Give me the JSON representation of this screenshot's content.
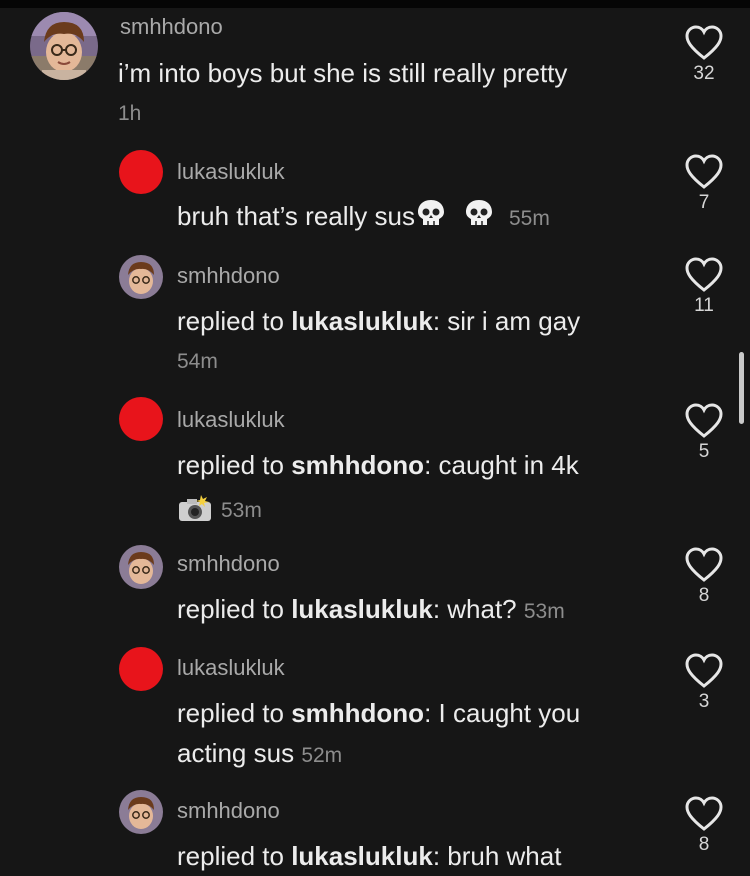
{
  "comments": [
    {
      "username": "smhhdono",
      "text": "i’m into boys but she is still really pretty",
      "time": "1h",
      "likes": "32"
    }
  ],
  "replies": [
    {
      "username": "lukaslukluk",
      "text": "bruh that’s really sus",
      "time": "55m",
      "likes": "7"
    },
    {
      "username": "smhhdono",
      "reply_prefix": "replied to ",
      "reply_to": "lukaslukluk",
      "text": ": sir i am gay",
      "time": "54m",
      "likes": "11"
    },
    {
      "username": "lukaslukluk",
      "reply_prefix": "replied to ",
      "reply_to": "smhhdono",
      "text": ": caught in 4k",
      "time": "53m",
      "likes": "5"
    },
    {
      "username": "smhhdono",
      "reply_prefix": "replied to ",
      "reply_to": "lukaslukluk",
      "text": ": what?",
      "time": "53m",
      "likes": "8"
    },
    {
      "username": "lukaslukluk",
      "reply_prefix": "replied to ",
      "reply_to": "smhhdono",
      "text": ": I caught you",
      "text2": "acting sus",
      "time": "52m",
      "likes": "3"
    },
    {
      "username": "smhhdono",
      "reply_prefix": "replied to ",
      "reply_to": "lukaslukluk",
      "text": ": bruh what",
      "likes": "8"
    }
  ],
  "icons": {
    "like": "heart-outline-icon",
    "skull": "skull-emoji-icon",
    "camera": "camera-flash-emoji-icon"
  },
  "colors": {
    "background": "#161616",
    "avatar_red": "#e8141b",
    "username": "#a9a9a9",
    "text": "#ececec",
    "time": "#8d8d8d"
  }
}
